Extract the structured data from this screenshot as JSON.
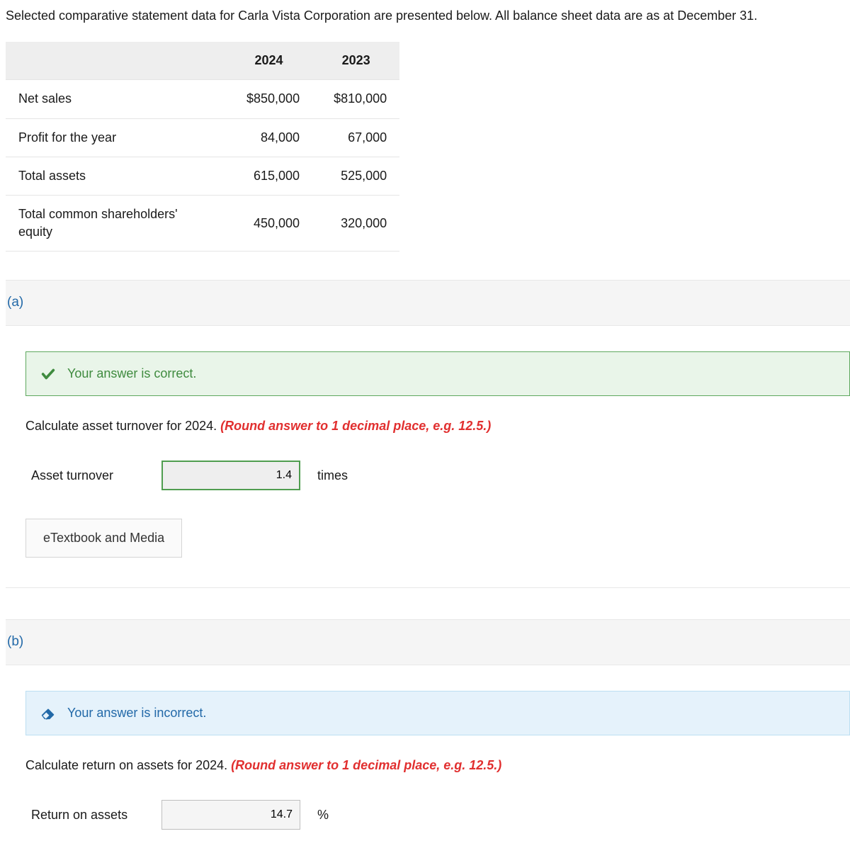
{
  "intro_text": "Selected comparative statement data for Carla Vista Corporation are presented below. All balance sheet data are as at December 31.",
  "table": {
    "col1": "2024",
    "col2": "2023",
    "rows": [
      {
        "label": "Net sales",
        "c1": "$850,000",
        "c2": "$810,000"
      },
      {
        "label": "Profit for the year",
        "c1": "84,000",
        "c2": "67,000"
      },
      {
        "label": "Total assets",
        "c1": "615,000",
        "c2": "525,000"
      },
      {
        "label": "Total common shareholders' equity",
        "c1": "450,000",
        "c2": "320,000"
      }
    ]
  },
  "part_a": {
    "label": "(a)",
    "feedback": "Your answer is correct.",
    "prompt_main": "Calculate asset turnover for 2024. ",
    "prompt_hint": "(Round answer to 1 decimal place, e.g. 12.5.)",
    "answer_label": "Asset turnover",
    "answer_value": "1.4",
    "unit": "times",
    "etext": "eTextbook and Media"
  },
  "part_b": {
    "label": "(b)",
    "feedback": "Your answer is incorrect.",
    "prompt_main": "Calculate return on assets for 2024. ",
    "prompt_hint": "(Round answer to 1 decimal place, e.g. 12.5.)",
    "answer_label": "Return on assets",
    "answer_value": "14.7",
    "unit": "%"
  }
}
